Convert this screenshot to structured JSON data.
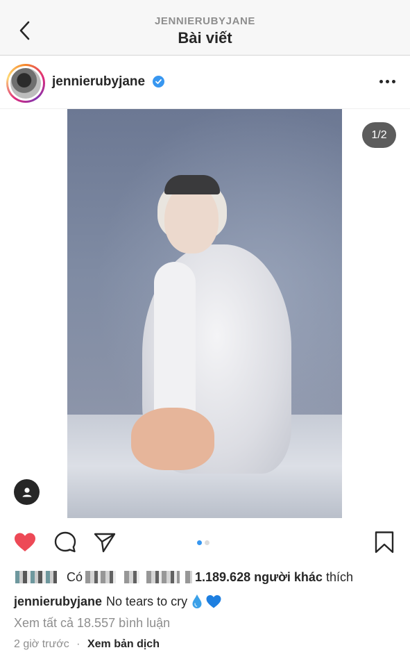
{
  "header": {
    "subtitle": "JENNIERUBYJANE",
    "title": "Bài viết",
    "back_icon": "chevron-left-icon"
  },
  "post": {
    "username": "jennierubyjane",
    "verified": true,
    "more_icon": "more-horizontal-icon",
    "page_indicator": "1/2",
    "carousel": {
      "current": 1,
      "total": 2
    },
    "tag_icon": "user-tag-icon"
  },
  "actions": {
    "like_icon": "heart-filled-icon",
    "comment_icon": "comment-icon",
    "share_icon": "send-icon",
    "save_icon": "bookmark-icon",
    "like_color": "#ed4956"
  },
  "likes": {
    "prefix": "Có",
    "count": "1.189.628",
    "others": "người khác",
    "suffix": "thích"
  },
  "caption": {
    "username": "jennierubyjane",
    "text": "No tears to cry",
    "emojis": [
      "droplet-icon",
      "blue-heart-icon"
    ]
  },
  "comments": {
    "view_all": "Xem tất cả 18.557 bình luận"
  },
  "meta": {
    "time": "2 giờ trước",
    "separator": "·",
    "translate": "Xem bản dịch"
  }
}
